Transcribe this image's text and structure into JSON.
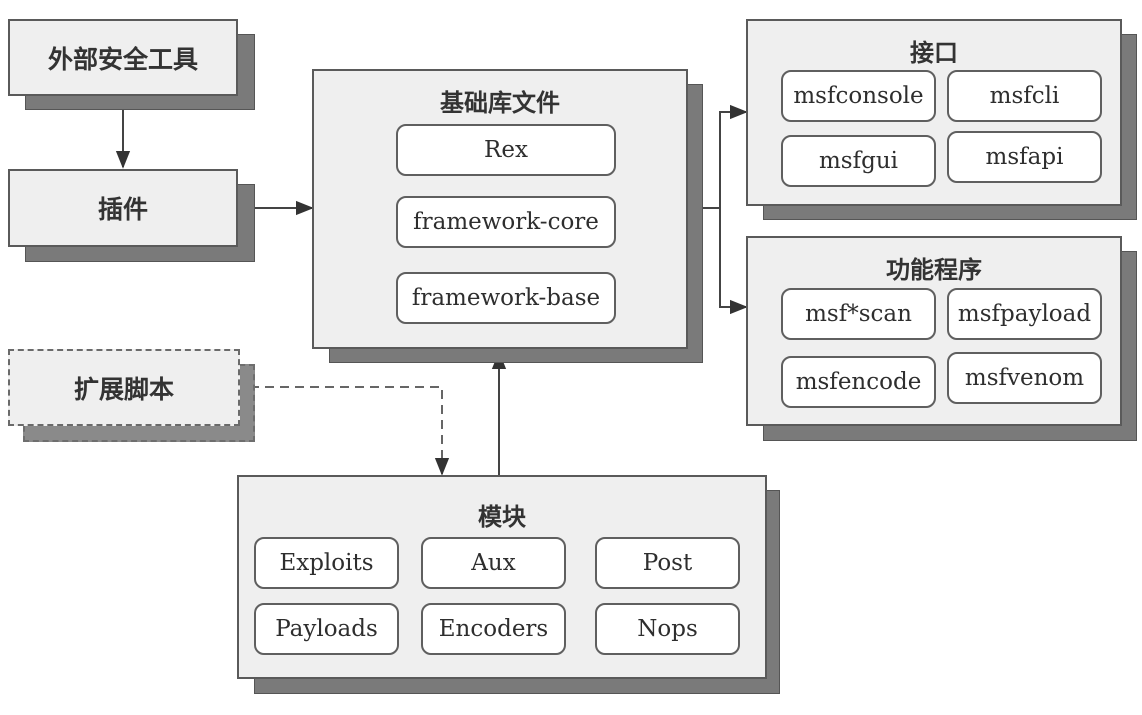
{
  "nodes": {
    "external_tools": {
      "label": "外部安全工具"
    },
    "plugins": {
      "label": "插件"
    },
    "extension_scripts": {
      "label": "扩展脚本"
    },
    "base_library": {
      "title": "基础库文件",
      "items": [
        "Rex",
        "framework-core",
        "framework-base"
      ]
    },
    "interfaces": {
      "title": "接口",
      "items": [
        "msfconsole",
        "msfcli",
        "msfgui",
        "msfapi"
      ]
    },
    "utilities": {
      "title": "功能程序",
      "items": [
        "msf*scan",
        "msfpayload",
        "msfencode",
        "msfvenom"
      ]
    },
    "modules": {
      "title": "模块",
      "items": [
        "Exploits",
        "Aux",
        "Post",
        "Payloads",
        "Encoders",
        "Nops"
      ]
    }
  },
  "edges": [
    {
      "from": "external_tools",
      "to": "plugins",
      "style": "solid"
    },
    {
      "from": "plugins",
      "to": "base_library",
      "style": "solid"
    },
    {
      "from": "Rex",
      "to": "framework-core",
      "style": "solid"
    },
    {
      "from": "framework-core",
      "to": "framework-base",
      "style": "solid"
    },
    {
      "from": "base_library",
      "to": "interfaces",
      "style": "solid"
    },
    {
      "from": "base_library",
      "to": "utilities",
      "style": "solid"
    },
    {
      "from": "modules",
      "to": "base_library",
      "style": "solid"
    },
    {
      "from": "extension_scripts",
      "to": "modules",
      "style": "dashed"
    }
  ]
}
